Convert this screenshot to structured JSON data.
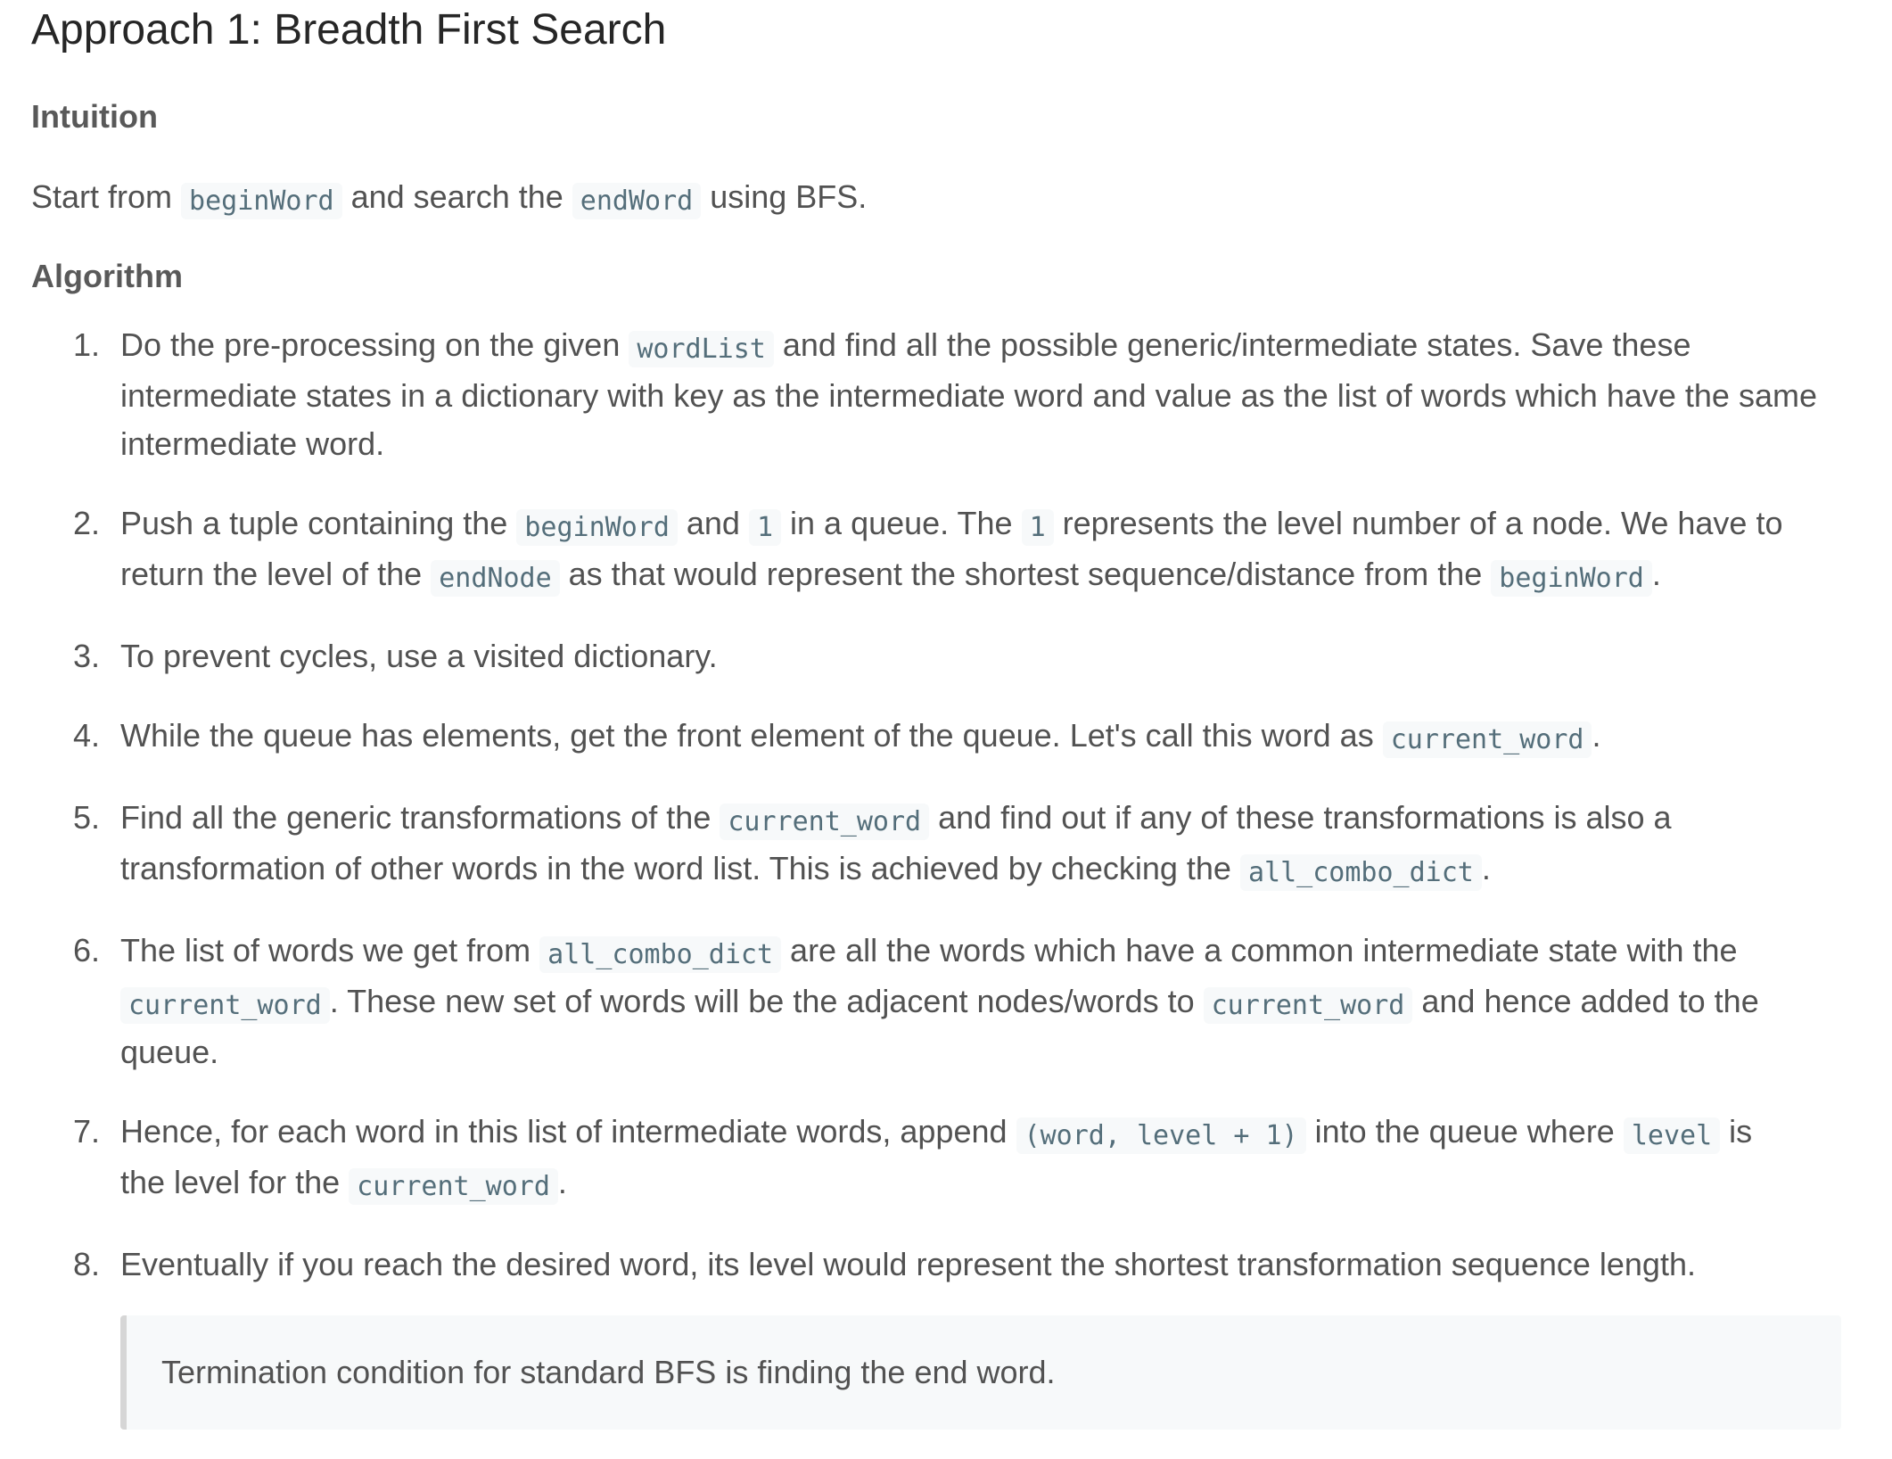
{
  "title": "Approach 1: Breadth First Search",
  "intuition": {
    "heading": "Intuition",
    "t1": "Start from ",
    "c1": "beginWord",
    "t2": " and search the ",
    "c2": "endWord",
    "t3": " using BFS."
  },
  "algorithm": {
    "heading": "Algorithm",
    "steps": [
      {
        "num": "1.",
        "t1": "Do the pre-processing on the given ",
        "c1": "wordList",
        "t2": " and find all the possible generic/intermediate states. Save these",
        "t3": "intermediate states in a dictionary with key as the intermediate word and value as the list of words which have the same",
        "t4": "intermediate word."
      },
      {
        "num": "2.",
        "t1": "Push a tuple containing the ",
        "c1": "beginWord",
        "t2": " and ",
        "c2": "1",
        "t3": " in a queue. The ",
        "c3": "1",
        "t4": " represents the level number of a node. We have to",
        "t5": "return the level of the ",
        "c4": "endNode",
        "t6": " as that would represent the shortest sequence/distance from the ",
        "c5": "beginWord",
        "t7": "."
      },
      {
        "num": "3.",
        "t1": "To prevent cycles, use a visited dictionary."
      },
      {
        "num": "4.",
        "t1": "While the queue has elements, get the front element of the queue. Let's call this word as ",
        "c1": "current_word",
        "t2": "."
      },
      {
        "num": "5.",
        "t1": "Find all the generic transformations of the ",
        "c1": "current_word",
        "t2": " and find out if any of these transformations is also a",
        "t3": "transformation of other words in the word list. This is achieved by checking the ",
        "c2": "all_combo_dict",
        "t4": "."
      },
      {
        "num": "6.",
        "t1": "The list of words we get from ",
        "c1": "all_combo_dict",
        "t2": " are all the words which have a common intermediate state with the",
        "c2": "current_word",
        "t3": ". These new set of words will be the adjacent nodes/words to ",
        "c3": "current_word",
        "t4": " and hence added to the",
        "t5": "queue."
      },
      {
        "num": "7.",
        "t1": "Hence, for each word in this list of intermediate words, append ",
        "c1": "(word, level + 1)",
        "t2": " into the queue where ",
        "c2": "level",
        "t3": " is",
        "t4": "the level for the ",
        "c3": "current_word",
        "t5": "."
      },
      {
        "num": "8.",
        "t1": "Eventually if you reach the desired word, its level would represent the shortest transformation sequence length."
      }
    ]
  },
  "note": "Termination condition for standard BFS is finding the end word."
}
